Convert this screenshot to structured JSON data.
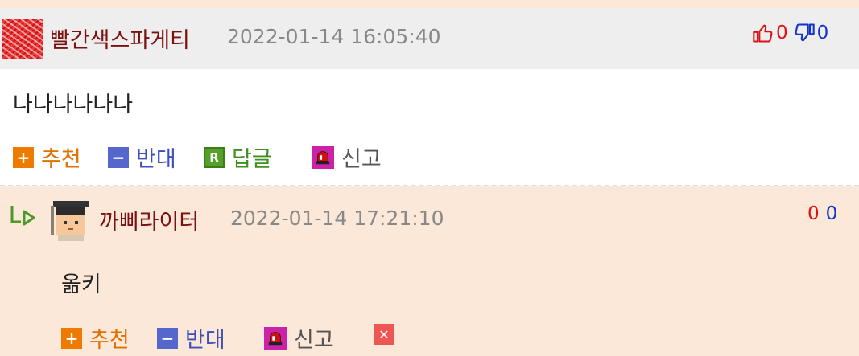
{
  "comments": [
    {
      "nickname": "빨간색스파게티",
      "datetime": "2022-01-14 16:05:40",
      "upvotes": "0",
      "downvotes": "0",
      "text": "나나나나나나",
      "actions": {
        "recommend": "추천",
        "oppose": "반대",
        "reply": "답글",
        "report": "신고"
      }
    },
    {
      "nickname": "까삐라이터",
      "datetime": "2022-01-14 17:21:10",
      "upvotes": "0",
      "downvotes": "0",
      "text": "옮키",
      "actions": {
        "recommend": "추천",
        "oppose": "반대",
        "report": "신고"
      }
    }
  ],
  "icons": {
    "plus": "+",
    "minus": "−",
    "reply_badge": "R",
    "delete": "✕"
  },
  "colors": {
    "header_bg": "#eeeeee",
    "reply_bg": "#fce8d8",
    "nickname": "#7a1010",
    "upvote": "#dd1111",
    "downvote": "#1133cc",
    "recommend": "#ee7a00",
    "oppose": "#5566cc",
    "reply": "#55a028",
    "report": "#cc22aa"
  }
}
